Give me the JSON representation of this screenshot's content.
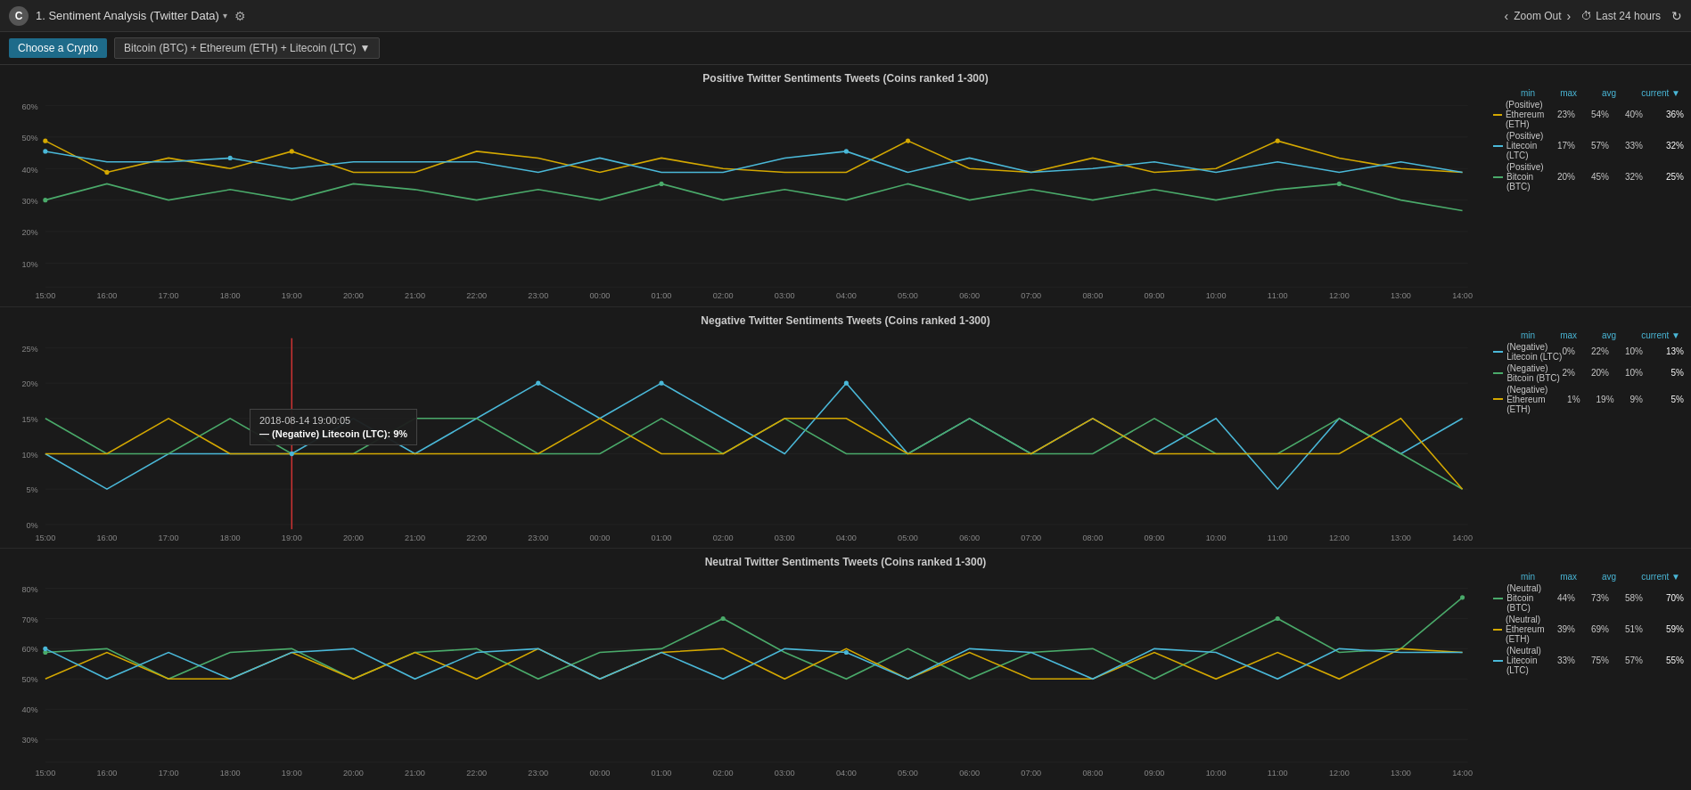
{
  "app": {
    "logo": "C",
    "dashboard_title": "1. Sentiment Analysis (Twitter Data)",
    "gear_icon": "⚙",
    "zoom_out_label": "Zoom Out",
    "time_range_icon": "⏱",
    "time_range_label": "Last 24 hours",
    "refresh_icon": "↻"
  },
  "filter": {
    "choose_crypto_label": "Choose a Crypto",
    "crypto_selection": "Bitcoin (BTC) + Ethereum (ETH) + Litecoin (LTC)",
    "dropdown_arrow": "▼"
  },
  "charts": {
    "positive": {
      "title": "Positive Twitter Sentiments Tweets (Coins ranked 1-300)",
      "y_labels": [
        "60%",
        "50%",
        "40%",
        "30%",
        "20%",
        "10%",
        ""
      ],
      "x_labels": [
        "15:00",
        "16:00",
        "17:00",
        "18:00",
        "19:00",
        "20:00",
        "21:00",
        "22:00",
        "23:00",
        "00:00",
        "01:00",
        "02:00",
        "03:00",
        "04:00",
        "05:00",
        "06:00",
        "07:00",
        "08:00",
        "09:00",
        "10:00",
        "11:00",
        "12:00",
        "13:00",
        "14:00"
      ],
      "legend": {
        "headers": [
          "min",
          "max",
          "avg",
          "current ▼"
        ],
        "items": [
          {
            "label": "(Positive) Ethereum (ETH)",
            "color": "#d4a800",
            "min": "23%",
            "max": "54%",
            "avg": "40%",
            "current": "36%"
          },
          {
            "label": "(Positive) Litecoin (LTC)",
            "color": "#4ab8d8",
            "min": "17%",
            "max": "57%",
            "avg": "33%",
            "current": "32%"
          },
          {
            "label": "(Positive) Bitcoin (BTC)",
            "color": "#4aaa6a",
            "min": "20%",
            "max": "45%",
            "avg": "32%",
            "current": "25%"
          }
        ]
      }
    },
    "negative": {
      "title": "Negative Twitter Sentiments Tweets (Coins ranked 1-300)",
      "y_labels": [
        "25%",
        "20%",
        "15%",
        "10%",
        "5%",
        "0%"
      ],
      "x_labels": [
        "15:00",
        "16:00",
        "17:00",
        "18:00",
        "19:00",
        "20:00",
        "21:00",
        "22:00",
        "23:00",
        "00:00",
        "01:00",
        "02:00",
        "03:00",
        "04:00",
        "05:00",
        "06:00",
        "07:00",
        "08:00",
        "09:00",
        "10:00",
        "11:00",
        "12:00",
        "13:00",
        "14:00"
      ],
      "tooltip": {
        "time": "2018-08-14 19:00:05",
        "label": "— (Negative) Litecoin (LTC):",
        "value": "9%"
      },
      "legend": {
        "headers": [
          "min",
          "max",
          "avg",
          "current ▼"
        ],
        "items": [
          {
            "label": "(Negative) Litecoin (LTC)",
            "color": "#4ab8d8",
            "min": "0%",
            "max": "22%",
            "avg": "10%",
            "current": "13%"
          },
          {
            "label": "(Negative) Bitcoin (BTC)",
            "color": "#4aaa6a",
            "min": "2%",
            "max": "20%",
            "avg": "10%",
            "current": "5%"
          },
          {
            "label": "(Negative) Ethereum (ETH)",
            "color": "#d4a800",
            "min": "1%",
            "max": "19%",
            "avg": "9%",
            "current": "5%"
          }
        ]
      }
    },
    "neutral": {
      "title": "Neutral Twitter Sentiments Tweets (Coins ranked 1-300)",
      "y_labels": [
        "80%",
        "70%",
        "60%",
        "50%",
        "40%",
        "30%"
      ],
      "x_labels": [
        "15:00",
        "16:00",
        "17:00",
        "18:00",
        "19:00",
        "20:00",
        "21:00",
        "22:00",
        "23:00",
        "00:00",
        "01:00",
        "02:00",
        "03:00",
        "04:00",
        "05:00",
        "06:00",
        "07:00",
        "08:00",
        "09:00",
        "10:00",
        "11:00",
        "12:00",
        "13:00",
        "14:00"
      ],
      "legend": {
        "headers": [
          "min",
          "max",
          "avg",
          "current ▼"
        ],
        "items": [
          {
            "label": "(Neutral) Bitcoin (BTC)",
            "color": "#4aaa6a",
            "min": "44%",
            "max": "73%",
            "avg": "58%",
            "current": "70%"
          },
          {
            "label": "(Neutral) Ethereum (ETH)",
            "color": "#d4a800",
            "min": "39%",
            "max": "69%",
            "avg": "51%",
            "current": "59%"
          },
          {
            "label": "(Neutral) Litecoin (LTC)",
            "color": "#4ab8d8",
            "min": "33%",
            "max": "75%",
            "avg": "57%",
            "current": "55%"
          }
        ]
      }
    }
  }
}
